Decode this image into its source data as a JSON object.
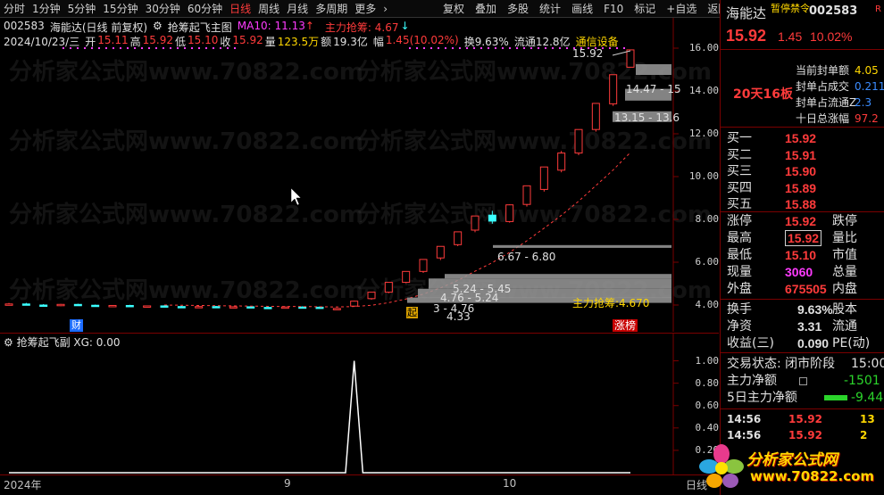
{
  "toolbar": {
    "periods": [
      "分时",
      "1分钟",
      "5分钟",
      "15分钟",
      "30分钟",
      "60分钟",
      "日线",
      "周线",
      "月线",
      "多周期",
      "更多"
    ],
    "active_period": "日线",
    "more_arrow": "›",
    "tools": [
      "复权",
      "叠加",
      "多股",
      "统计",
      "画线",
      "F10",
      "标记",
      "+自选",
      "返回"
    ]
  },
  "main": {
    "code": "002583",
    "name": "海能达",
    "mode": "(日线 前复权)",
    "indicator": "抢筹起飞主图",
    "ma10_label": "MA10: 11.13",
    "ma10_arrow": "↑",
    "zhuli_label": "主力抢筹: 4.67",
    "zhuli_arrow": "↓",
    "date": "2024/10/23/三",
    "open_label": "开",
    "open": "15.11",
    "high_label": "高",
    "high": "15.92",
    "low_label": "低",
    "low": "15.10",
    "close_label": "收",
    "close": "15.92",
    "vol_label": "量",
    "vol": "123.5万",
    "amt_label": "额",
    "amt": "19.3亿",
    "chg_label": "幅",
    "chg": "1.45(10.02%)",
    "turnover": "换9.63%",
    "float_cap": "流通12.8亿",
    "sector": "通信设备",
    "cur_price_tag": "15.92",
    "levels": [
      "14.47 - 15",
      "13.15 - 13.6",
      "6.67 - 6.80",
      "5.24 - 5.45",
      "4.76 - 5.24",
      "3 - 4.76",
      "4.33"
    ],
    "zhuli_box": "主力抢筹:4.670",
    "zhangbang": "涨榜",
    "cai": "财",
    "qi": "起",
    "yticks": [
      "16.00",
      "14.00",
      "12.00",
      "10.00",
      "8.00",
      "6.00",
      "4.00"
    ],
    "watermark": "分析家公式网www.70822.com"
  },
  "sub": {
    "title": "抢筹起飞副 XG: 0.00",
    "yticks": [
      "1.00",
      "0.80",
      "0.60",
      "0.40",
      "0.20"
    ]
  },
  "xaxis": {
    "labels": [
      "2024年",
      "9",
      "10",
      "日线"
    ]
  },
  "panel": {
    "name": "海能达",
    "status_tag": "暂停禁令",
    "code": "002583",
    "r_tag": "R",
    "price": "15.92",
    "change": "1.45",
    "pct": "10.02%",
    "streak": "20天16板",
    "stats": [
      {
        "label": "当前封单额",
        "value": "4.05"
      },
      {
        "label": "封单占成交",
        "value": "0.211"
      },
      {
        "label": "封单占流通Z",
        "value": "2.3"
      },
      {
        "label": "十日总涨幅",
        "value": "97.2"
      }
    ],
    "order_book": [
      {
        "label": "买一",
        "price": "15.92"
      },
      {
        "label": "买二",
        "price": "15.91"
      },
      {
        "label": "买三",
        "price": "15.90"
      },
      {
        "label": "买四",
        "price": "15.89"
      },
      {
        "label": "买五",
        "price": "15.88"
      }
    ],
    "quote": [
      {
        "l1": "涨停",
        "v1": "15.92",
        "l2": "跌停"
      },
      {
        "l1": "最高",
        "v1": "15.92",
        "l2": "量比"
      },
      {
        "l1": "最低",
        "v1": "15.10",
        "l2": "市值"
      },
      {
        "l1": "现量",
        "v1": "3060",
        "l2": "总量"
      },
      {
        "l1": "外盘",
        "v1": "675505",
        "l2": "内盘"
      }
    ],
    "fin": [
      {
        "l1": "换手",
        "v1": "9.63%",
        "l2": "股本"
      },
      {
        "l1": "净资",
        "v1": "3.31",
        "l2": "流通"
      },
      {
        "l1": "收益(三)",
        "v1": "0.090",
        "l2": "PE(动)"
      }
    ],
    "trade_status": "交易状态: 闭市阶段",
    "trade_time": "15:00",
    "net_flow": [
      {
        "label": "主力净额",
        "value": "-1501"
      },
      {
        "label": "5日主力净额",
        "value": "-9.44"
      }
    ],
    "ticks": [
      {
        "time": "14:56",
        "price": "15.92",
        "vol": "13"
      },
      {
        "time": "14:56",
        "price": "15.92",
        "vol": "2"
      }
    ]
  },
  "logo": {
    "text": "分析家公式网",
    "url": "www.70822.com"
  },
  "colors": {
    "up": "#ff3b3b",
    "down": "#3bffff",
    "ma": "#ff3b3b",
    "bg": "#000000",
    "axis": "#7a0000"
  },
  "chart_data": {
    "type": "candlestick",
    "x": [
      "2024-08-23",
      "2024-08-26",
      "2024-08-27",
      "2024-08-28",
      "2024-08-29",
      "2024-08-30",
      "2024-09-02",
      "2024-09-03",
      "2024-09-04",
      "2024-09-05",
      "2024-09-06",
      "2024-09-09",
      "2024-09-10",
      "2024-09-11",
      "2024-09-12",
      "2024-09-13",
      "2024-09-18",
      "2024-09-19",
      "2024-09-20",
      "2024-09-23",
      "2024-09-24",
      "2024-09-25",
      "2024-09-26",
      "2024-09-27",
      "2024-09-30",
      "2024-10-08",
      "2024-10-09",
      "2024-10-10",
      "2024-10-11",
      "2024-10-14",
      "2024-10-15",
      "2024-10-16",
      "2024-10-17",
      "2024-10-18",
      "2024-10-21",
      "2024-10-22",
      "2024-10-23"
    ],
    "open": [
      4.02,
      4.05,
      4.0,
      3.98,
      4.03,
      3.99,
      3.97,
      3.98,
      3.95,
      3.96,
      3.93,
      3.92,
      3.93,
      3.9,
      3.92,
      3.89,
      3.88,
      3.91,
      3.9,
      3.8,
      3.95,
      4.3,
      4.6,
      5.06,
      5.57,
      6.2,
      6.82,
      7.5,
      8.2,
      7.9,
      8.7,
      9.4,
      10.3,
      11.1,
      12.2,
      13.4,
      15.11
    ],
    "high": [
      4.1,
      4.1,
      4.04,
      4.05,
      4.06,
      4.02,
      4.0,
      4.01,
      3.98,
      3.99,
      3.96,
      3.96,
      3.96,
      3.94,
      3.94,
      3.93,
      3.93,
      3.94,
      3.93,
      3.85,
      4.2,
      4.6,
      5.06,
      5.57,
      6.13,
      6.74,
      7.42,
      8.16,
      8.4,
      8.7,
      9.57,
      10.45,
      11.2,
      12.2,
      13.42,
      14.76,
      15.92
    ],
    "low": [
      3.98,
      3.99,
      3.96,
      3.95,
      3.99,
      3.95,
      3.93,
      3.94,
      3.91,
      3.92,
      3.89,
      3.88,
      3.89,
      3.87,
      3.88,
      3.85,
      3.86,
      3.88,
      3.86,
      3.78,
      3.92,
      4.25,
      4.55,
      5.02,
      5.5,
      6.1,
      6.75,
      7.4,
      7.8,
      7.85,
      8.6,
      9.3,
      10.2,
      11.0,
      12.1,
      13.3,
      15.1
    ],
    "close": [
      4.05,
      4.0,
      3.98,
      4.03,
      3.99,
      3.97,
      3.98,
      3.95,
      3.96,
      3.93,
      3.92,
      3.93,
      3.9,
      3.92,
      3.89,
      3.88,
      3.91,
      3.9,
      3.89,
      3.84,
      4.18,
      4.6,
      5.06,
      5.57,
      6.13,
      6.74,
      7.42,
      8.16,
      7.92,
      8.68,
      9.57,
      10.45,
      11.1,
      12.2,
      13.42,
      14.76,
      15.92
    ],
    "ma10": [
      null,
      null,
      null,
      null,
      null,
      null,
      null,
      null,
      null,
      4.0,
      3.99,
      3.98,
      3.97,
      3.96,
      3.95,
      3.94,
      3.93,
      3.93,
      3.92,
      3.91,
      3.93,
      3.99,
      4.11,
      4.28,
      4.51,
      4.8,
      5.15,
      5.58,
      5.98,
      6.46,
      7.0,
      7.59,
      8.19,
      8.85,
      9.58,
      10.31,
      11.13
    ],
    "ylim": [
      3.0,
      16.6
    ],
    "sub_series": {
      "name": "XG",
      "values": [
        0,
        0,
        0,
        0,
        0,
        0,
        0,
        0,
        0,
        0,
        0,
        0,
        0,
        0,
        0,
        0,
        0,
        0,
        0,
        0,
        1,
        0,
        0,
        0,
        0,
        0,
        0,
        0,
        0,
        0,
        0,
        0,
        0,
        0,
        0,
        0,
        0
      ]
    },
    "sub_ylim": [
      0,
      1.1
    ]
  }
}
